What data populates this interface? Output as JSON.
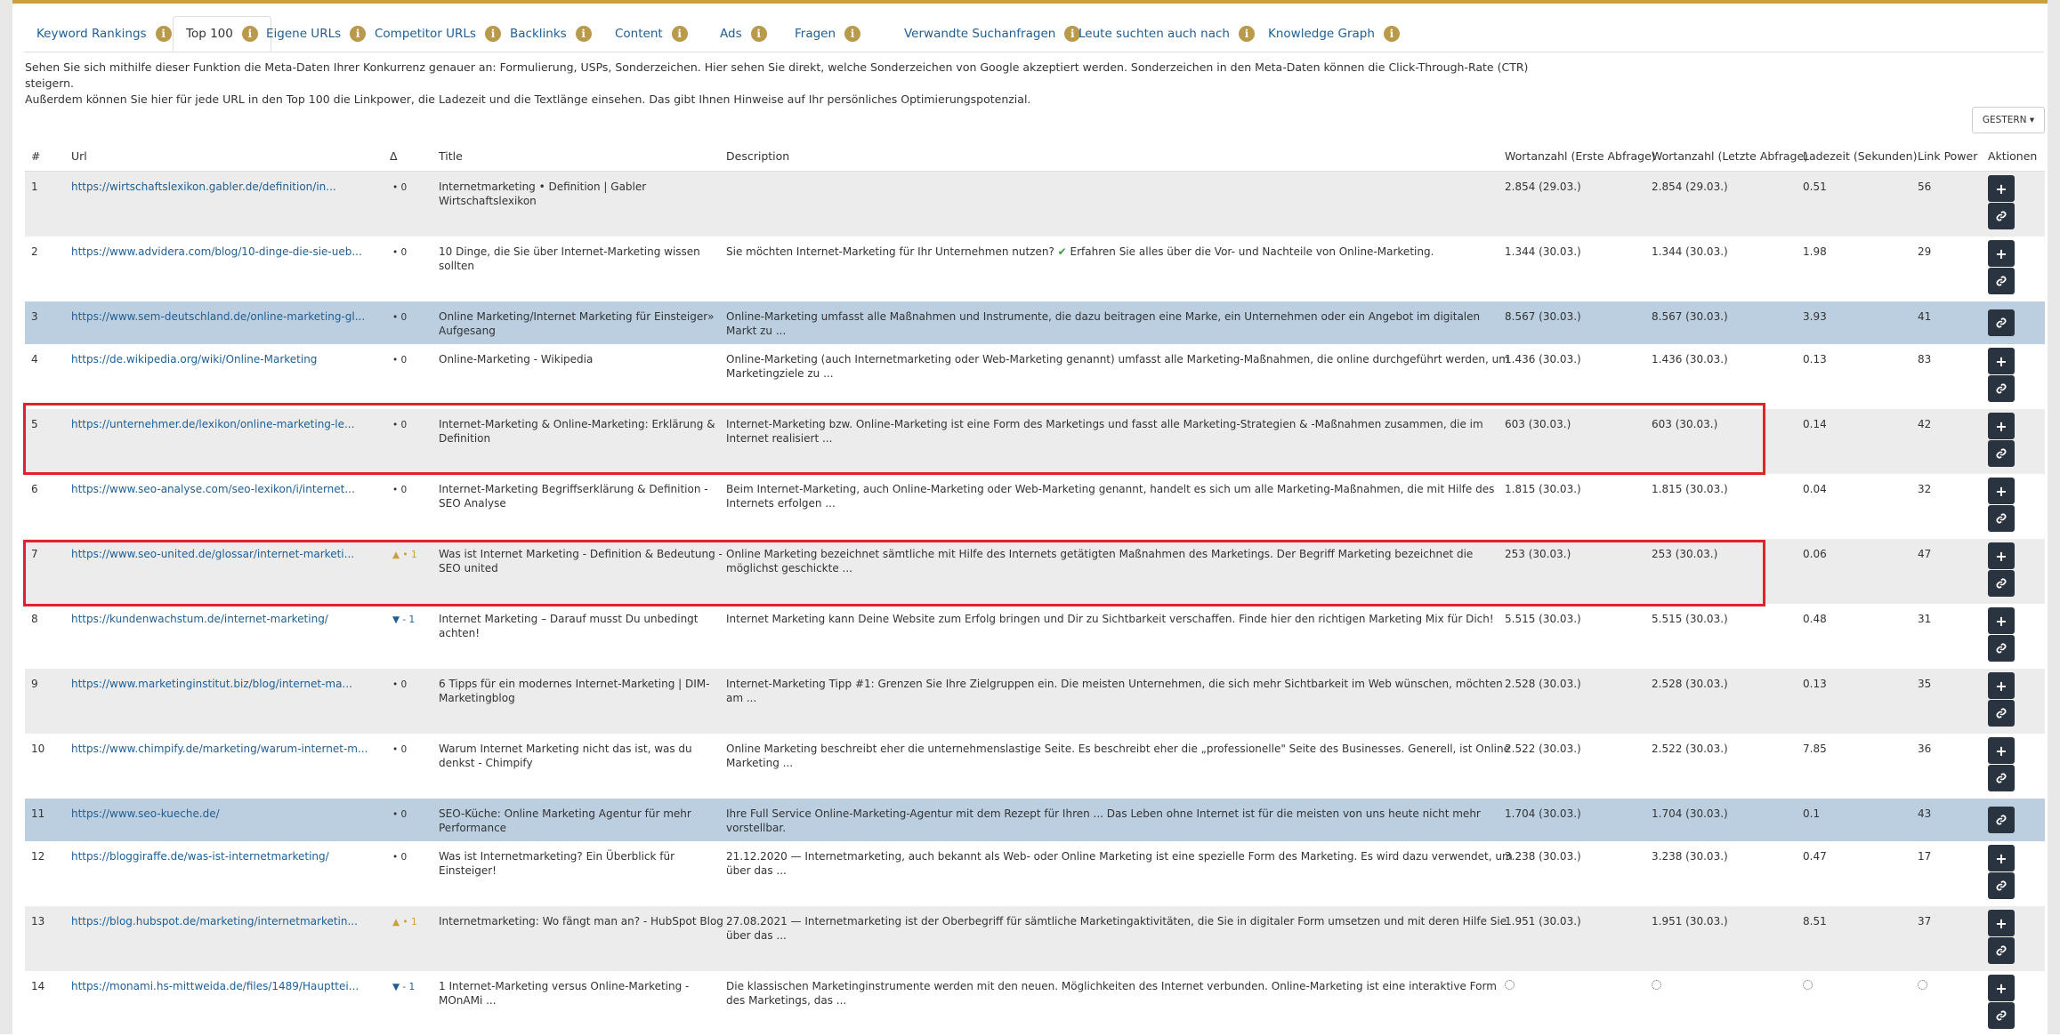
{
  "tabs": [
    {
      "label": "Keyword Rankings",
      "active": false
    },
    {
      "label": "Top 100",
      "active": true
    },
    {
      "label": "Eigene URLs",
      "active": false
    },
    {
      "label": "Competitor URLs",
      "active": false
    },
    {
      "label": "Backlinks",
      "active": false
    },
    {
      "label": "Content",
      "active": false
    },
    {
      "label": "Ads",
      "active": false
    },
    {
      "label": "Fragen",
      "active": false
    },
    {
      "label": "Verwandte Suchanfragen",
      "active": false
    },
    {
      "label": "Leute suchten auch nach",
      "active": false
    },
    {
      "label": "Knowledge Graph",
      "active": false
    }
  ],
  "info_icon_glyph": "i",
  "intro": {
    "line1": "Sehen Sie sich mithilfe dieser Funktion die Meta-Daten Ihrer Konkurrenz genauer an: Formulierung, USPs, Sonderzeichen. Hier sehen Sie direkt, welche Sonderzeichen von Google akzeptiert werden. Sonderzeichen in den Meta-Daten können die Click-Through-Rate (CTR) steigern.",
    "line2": "Außerdem können Sie hier für jede URL in den Top 100 die Linkpower, die Ladezeit und die Textlänge einsehen. Das gibt Ihnen Hinweise auf Ihr persönliches Optimierungspotenzial."
  },
  "date_button": {
    "label": "GESTERN ▾"
  },
  "table": {
    "headers": {
      "num": "#",
      "url": "Url",
      "delta": "Δ",
      "title": "Title",
      "description": "Description",
      "words_first": "Wortanzahl (Erste Abfrage)",
      "words_last": "Wortanzahl (Letzte Abfrage)",
      "load_time": "Ladezeit (Sekunden)",
      "link_power": "Link Power",
      "actions": "Aktionen"
    },
    "rows": [
      {
        "num": "1",
        "url": "https://wirtschaftslexikon.gabler.de/definition/in...",
        "delta_arrow": "",
        "delta": "• 0",
        "title": "Internetmarketing • Definition | Gabler Wirtschaftslexikon",
        "description": "",
        "words_first": "2.854 (29.03.)",
        "words_last": "2.854 (29.03.)",
        "load_time": "0.51",
        "link_power": "56"
      },
      {
        "num": "2",
        "url": "https://www.advidera.com/blog/10-dinge-die-sie-ueb...",
        "delta_arrow": "",
        "delta": "• 0",
        "title": "10 Dinge, die Sie über Internet-Marketing wissen sollten",
        "description_pre": "Sie möchten Internet-Marketing für Ihr Unternehmen nutzen? ",
        "description_check": "✔",
        "description_post": " Erfahren Sie alles über die Vor- und Nachteile von Online-Marketing.",
        "words_first": "1.344 (30.03.)",
        "words_last": "1.344 (30.03.)",
        "load_time": "1.98",
        "link_power": "29"
      },
      {
        "num": "3",
        "url": "https://www.sem-deutschland.de/online-marketing-gl...",
        "delta_arrow": "",
        "delta": "• 0",
        "title": "Online Marketing/Internet Marketing für Einsteiger» Aufgesang",
        "description": "Online-Marketing umfasst alle Maßnahmen und Instrumente, die dazu beitragen eine Marke, ein Unternehmen oder ein Angebot im digitalen Markt zu ...",
        "words_first": "8.567 (30.03.)",
        "words_last": "8.567 (30.03.)",
        "load_time": "3.93",
        "link_power": "41"
      },
      {
        "num": "4",
        "url": "https://de.wikipedia.org/wiki/Online-Marketing",
        "delta_arrow": "",
        "delta": "• 0",
        "title": "Online-Marketing - Wikipedia",
        "description": "Online-Marketing (auch Internetmarketing oder Web-Marketing genannt) umfasst alle Marketing-Maßnahmen, die online durchgeführt werden, um Marketingziele zu ...",
        "words_first": "1.436 (30.03.)",
        "words_last": "1.436 (30.03.)",
        "load_time": "0.13",
        "link_power": "83"
      },
      {
        "num": "5",
        "url": "https://unternehmer.de/lexikon/online-marketing-le...",
        "delta_arrow": "",
        "delta": "• 0",
        "title": "Internet-Marketing & Online-Marketing: Erklärung & Definition",
        "description": "Internet-Marketing bzw. Online-Marketing ist eine Form des Marketings und fasst alle Marketing-Strategien & -Maßnahmen zusammen, die im Internet realisiert ...",
        "words_first": "603 (30.03.)",
        "words_last": "603 (30.03.)",
        "load_time": "0.14",
        "link_power": "42"
      },
      {
        "num": "6",
        "url": "https://www.seo-analyse.com/seo-lexikon/i/internet...",
        "delta_arrow": "",
        "delta": "• 0",
        "title": "Internet-Marketing Begriffserklärung & Definition - SEO Analyse",
        "description": "Beim Internet-Marketing, auch Online-Marketing oder Web-Marketing genannt, handelt es sich um alle Marketing-Maßnahmen, die mit Hilfe des Internets erfolgen ...",
        "words_first": "1.815 (30.03.)",
        "words_last": "1.815 (30.03.)",
        "load_time": "0.04",
        "link_power": "32"
      },
      {
        "num": "7",
        "url": "https://www.seo-united.de/glossar/internet-marketi...",
        "delta_arrow": "▲",
        "delta": "• 1",
        "title": "Was ist Internet Marketing - Definition & Bedeutung - SEO united",
        "description": "Online Marketing bezeichnet sämtliche mit Hilfe des Internets getätigten Maßnahmen des Marketings. Der Begriff Marketing bezeichnet die möglichst geschickte ...",
        "words_first": "253 (30.03.)",
        "words_last": "253 (30.03.)",
        "load_time": "0.06",
        "link_power": "47"
      },
      {
        "num": "8",
        "url": "https://kundenwachstum.de/internet-marketing/",
        "delta_arrow": "▼",
        "delta": "- 1",
        "title": "Internet Marketing – Darauf musst Du unbedingt achten!",
        "description": "Internet Marketing kann Deine Website zum Erfolg bringen und Dir zu Sichtbarkeit verschaffen. Finde hier den richtigen Marketing Mix für Dich!",
        "words_first": "5.515 (30.03.)",
        "words_last": "5.515 (30.03.)",
        "load_time": "0.48",
        "link_power": "31"
      },
      {
        "num": "9",
        "url": "https://www.marketinginstitut.biz/blog/internet-ma...",
        "delta_arrow": "",
        "delta": "• 0",
        "title": "6 Tipps für ein modernes Internet-Marketing | DIM-Marketingblog",
        "description": "Internet-Marketing Tipp #1: Grenzen Sie Ihre Zielgruppen ein. Die meisten Unternehmen, die sich mehr Sichtbarkeit im Web wünschen, möchten am ...",
        "words_first": "2.528 (30.03.)",
        "words_last": "2.528 (30.03.)",
        "load_time": "0.13",
        "link_power": "35"
      },
      {
        "num": "10",
        "url": "https://www.chimpify.de/marketing/warum-internet-m...",
        "delta_arrow": "",
        "delta": "• 0",
        "title": "Warum Internet Marketing nicht das ist, was du denkst - Chimpify",
        "description": "Online Marketing beschreibt eher die unternehmenslastige Seite. Es beschreibt eher die „professionelle\" Seite des Businesses. Generell, ist Online Marketing ...",
        "words_first": "2.522 (30.03.)",
        "words_last": "2.522 (30.03.)",
        "load_time": "7.85",
        "link_power": "36"
      },
      {
        "num": "11",
        "url": "https://www.seo-kueche.de/",
        "delta_arrow": "",
        "delta": "• 0",
        "title": "SEO-Küche: Online Marketing Agentur für mehr Performance",
        "description": "Ihre Full Service Online-Marketing-Agentur mit dem Rezept für Ihren ... Das Leben ohne Internet ist für die meisten von uns heute nicht mehr vorstellbar.",
        "words_first": "1.704 (30.03.)",
        "words_last": "1.704 (30.03.)",
        "load_time": "0.1",
        "link_power": "43"
      },
      {
        "num": "12",
        "url": "https://bloggiraffe.de/was-ist-internetmarketing/",
        "delta_arrow": "",
        "delta": "• 0",
        "title": "Was ist Internetmarketing? Ein Überblick für Einsteiger!",
        "description": "21.12.2020 — Internetmarketing, auch bekannt als Web- oder Online Marketing ist eine spezielle Form des Marketing. Es wird dazu verwendet, um über das ...",
        "words_first": "3.238 (30.03.)",
        "words_last": "3.238 (30.03.)",
        "load_time": "0.47",
        "link_power": "17"
      },
      {
        "num": "13",
        "url": "https://blog.hubspot.de/marketing/internetmarketin...",
        "delta_arrow": "▲",
        "delta": "• 1",
        "title": "Internetmarketing: Wo fängt man an? - HubSpot Blog",
        "description": "27.08.2021 — Internetmarketing ist der Oberbegriff für sämtliche Marketingaktivitäten, die Sie in digitaler Form umsetzen und mit deren Hilfe Sie über das ...",
        "words_first": "1.951 (30.03.)",
        "words_last": "1.951 (30.03.)",
        "load_time": "8.51",
        "link_power": "37"
      },
      {
        "num": "14",
        "url": "https://monami.hs-mittweida.de/files/1489/Haupttei...",
        "delta_arrow": "▼",
        "delta": "- 1",
        "title": "1 Internet-Marketing versus Online-Marketing - MOnAMi ...",
        "description": "Die klassischen Marketinginstrumente werden mit den neuen. Möglichkeiten des Internet verbunden. Online-Marketing ist eine interaktive Form des Marketings, das ...",
        "words_first": "",
        "words_last": "",
        "load_time": "",
        "link_power": ""
      }
    ]
  },
  "actions": {
    "add_glyph": "+"
  },
  "colors": {
    "accent_gold": "#c8a13c",
    "link_blue": "#1f5e93",
    "row_grey": "#ececec",
    "row_blue": "#bccfe0",
    "action_button": "#2a3440",
    "highlight_red": "#e0222e"
  }
}
